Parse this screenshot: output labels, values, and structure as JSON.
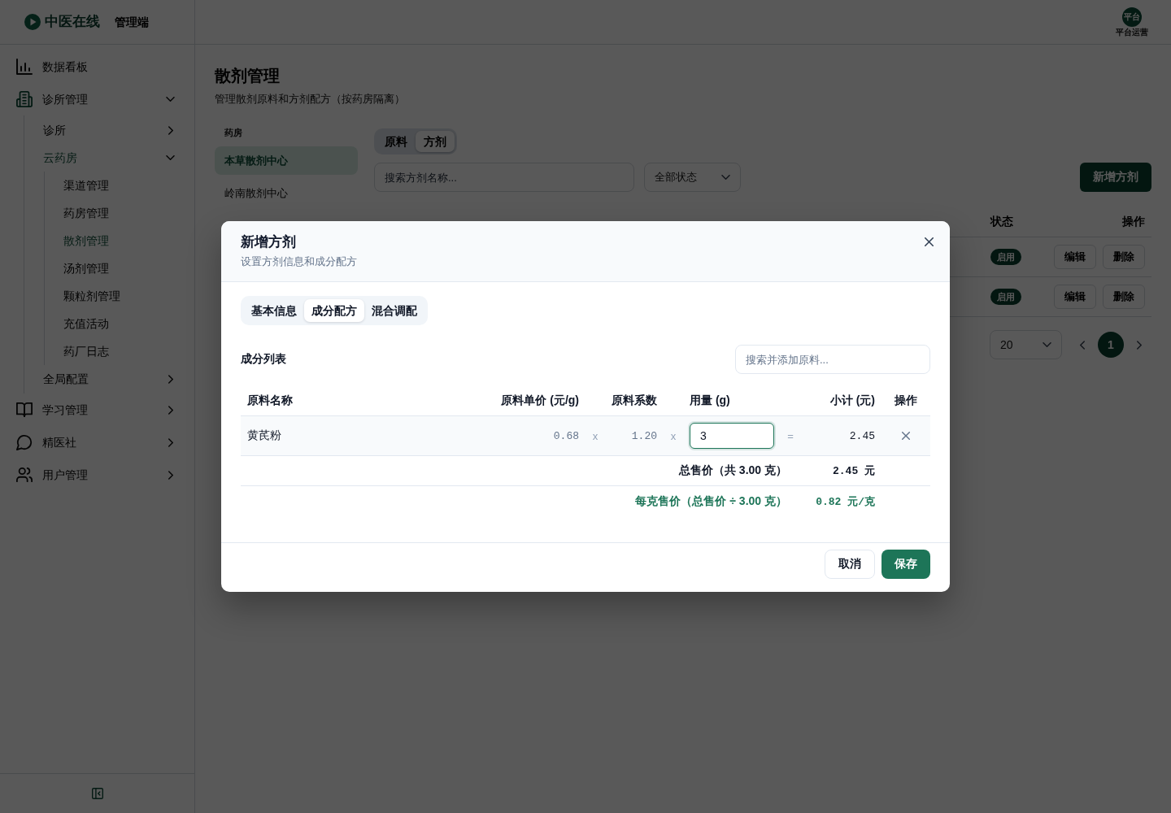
{
  "sidebar": {
    "brand": "中医在线",
    "app_label": "管理端",
    "items": [
      {
        "label": "数据看板",
        "selected": false
      },
      {
        "label": "诊所管理",
        "expanded": true,
        "children": [
          {
            "label": "诊所",
            "expanded": false
          },
          {
            "label": "云药房",
            "expanded": true,
            "children": [
              {
                "label": "渠道管理",
                "selected": false
              },
              {
                "label": "药房管理",
                "selected": false
              },
              {
                "label": "散剂管理",
                "selected": true
              },
              {
                "label": "汤剂管理",
                "selected": false
              },
              {
                "label": "颗粒剂管理",
                "selected": false
              },
              {
                "label": "充值活动",
                "selected": false
              },
              {
                "label": "药厂日志",
                "selected": false
              }
            ]
          },
          {
            "label": "全局配置",
            "expanded": false
          }
        ]
      },
      {
        "label": "学习管理",
        "expanded": false
      },
      {
        "label": "精医社",
        "expanded": false
      },
      {
        "label": "用户管理",
        "expanded": false
      }
    ]
  },
  "user": {
    "avatar": "平台",
    "name": "平台运营"
  },
  "page": {
    "title": "散剂管理",
    "subtitle": "管理散剂原料和方剂配方（按药房隔离）"
  },
  "pharmacies": {
    "label": "药房",
    "items": [
      {
        "label": "本草散剂中心",
        "selected": true
      },
      {
        "label": "岭南散剂中心",
        "selected": false
      }
    ]
  },
  "view_tabs": [
    {
      "label": "原料",
      "selected": false
    },
    {
      "label": "方剂",
      "selected": true
    }
  ],
  "filters": {
    "search": {
      "placeholder": "搜索方剂名称..."
    },
    "status": {
      "value": "全部状态"
    }
  },
  "add_button": "新增方剂",
  "table": {
    "columns": [
      "状态",
      "操作"
    ],
    "rows": [
      {
        "status": "启用",
        "actions": [
          "编辑",
          "删除"
        ]
      },
      {
        "status": "启用",
        "actions": [
          "编辑",
          "删除"
        ]
      }
    ]
  },
  "pagination": {
    "page_size": "20",
    "pages": [
      {
        "label": "1",
        "selected": true
      }
    ]
  },
  "modal": {
    "title": "新增方剂",
    "subtitle": "设置方剂信息和成分配方",
    "tabs": [
      {
        "label": "基本信息",
        "selected": false
      },
      {
        "label": "成分配方",
        "selected": true
      },
      {
        "label": "混合调配",
        "selected": false
      }
    ],
    "ingredients": {
      "title": "成分列表",
      "search": {
        "placeholder": "搜索并添加原料..."
      },
      "columns": [
        "原料名称",
        "原料单价 (元/g)",
        "原料系数",
        "用量 (g)",
        "小计 (元)",
        "操作"
      ],
      "rows": [
        {
          "name": "黄芪粉",
          "unit_price": "0.68",
          "times_1": "x",
          "coefficient": "1.20",
          "times_2": "x",
          "quantity": {
            "value": "3",
            "focused": true
          },
          "equals": "=",
          "subtotal": "2.45"
        }
      ],
      "total": {
        "label": "总售价（共 3.00 克）",
        "value": "2.45 元"
      },
      "per_gram": {
        "label": "每克售价（总售价 ÷ 3.00 克）",
        "value": "0.82 元/克"
      }
    },
    "buttons": [
      {
        "label": "取消",
        "kind": "secondary"
      },
      {
        "label": "保存",
        "kind": "primary"
      }
    ]
  }
}
